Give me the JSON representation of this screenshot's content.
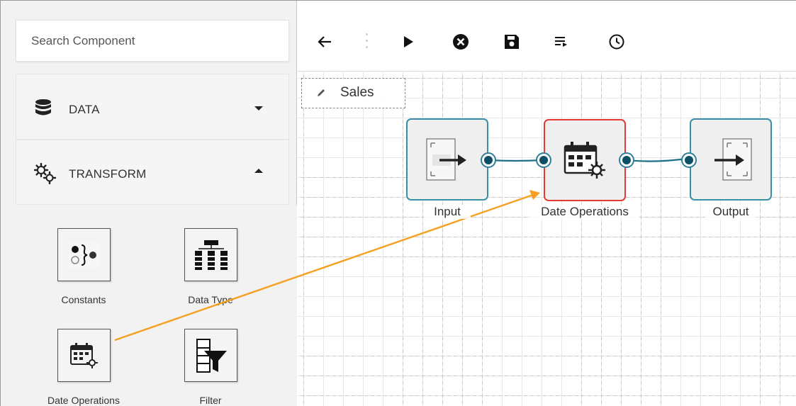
{
  "search": {
    "placeholder": "Search Component"
  },
  "sections": {
    "data": {
      "label": "DATA",
      "icon": "database-icon",
      "state": "collapsed"
    },
    "transform": {
      "label": "TRANSFORM",
      "icon": "gears-icon",
      "state": "expanded"
    }
  },
  "components": [
    {
      "label": "Constants",
      "icon": "constants-icon"
    },
    {
      "label": "Data Type",
      "icon": "data-type-icon"
    },
    {
      "label": "Date Operations",
      "icon": "calendar-gear-icon"
    },
    {
      "label": "Filter",
      "icon": "filter-icon"
    }
  ],
  "toolbar": {
    "back": "arrow-left-icon",
    "run": "play-icon",
    "stop": "close-circle-icon",
    "save": "save-icon",
    "logs": "list-arrow-icon",
    "history": "clock-icon"
  },
  "pipeline": {
    "name": "Sales"
  },
  "nodes": [
    {
      "label": "Input",
      "icon": "input-icon"
    },
    {
      "label": "Date Operations",
      "icon": "calendar-gear-icon",
      "selected": true
    },
    {
      "label": "Output",
      "icon": "output-icon"
    }
  ],
  "colors": {
    "node_border": "#3a8fa8",
    "selected_border": "#e53935",
    "connector": "#1f6e86",
    "drag_arrow": "#f5a020"
  }
}
